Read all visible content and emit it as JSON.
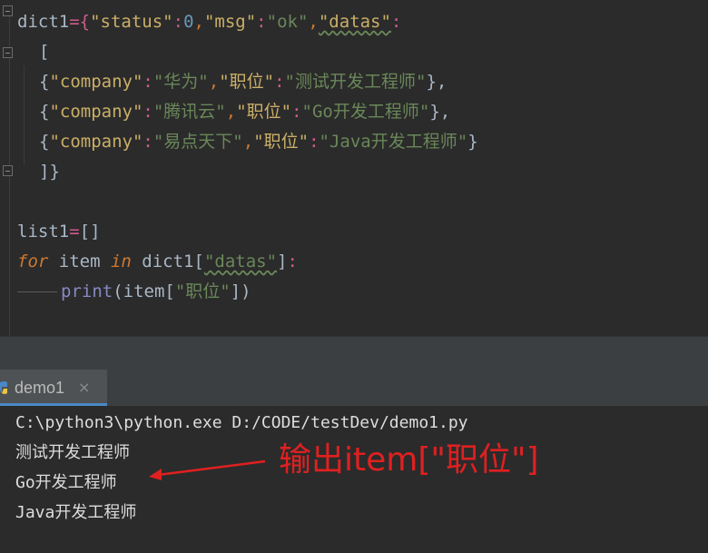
{
  "code": {
    "l1": {
      "a": "dict1",
      "b": "={",
      "c": "\"status\"",
      "d": ":",
      "e": "0",
      "f": ",",
      "g": "\"msg\"",
      "h": ":",
      "i": "\"ok\"",
      "j": ",",
      "k": "\"datas\"",
      "l": ":"
    },
    "l2": {
      "a": "["
    },
    "l3": {
      "a": "{",
      "b": "\"company\"",
      "c": ":",
      "d": "\"华为\"",
      "e": ",",
      "f": "\"职位\"",
      "g": ":",
      "h": "\"测试开发工程师\"",
      "i": "},"
    },
    "l4": {
      "a": "{",
      "b": "\"company\"",
      "c": ":",
      "d": "\"腾讯云\"",
      "e": ",",
      "f": "\"职位\"",
      "g": ":",
      "h": "\"Go开发工程师\"",
      "i": "},"
    },
    "l5": {
      "a": "{",
      "b": "\"company\"",
      "c": ":",
      "d": "\"易点天下\"",
      "e": ",",
      "f": "\"职位\"",
      "g": ":",
      "h": "\"Java开发工程师\"",
      "i": "}"
    },
    "l6": {
      "a": "]}"
    },
    "l8": {
      "a": "list1",
      "b": "=",
      "c": "[]"
    },
    "l9": {
      "a": "for",
      "b": " item ",
      "c": "in",
      "d": " dict1[",
      "e": "\"datas\"",
      "f": "]",
      "g": ":"
    },
    "l10": {
      "a": "print",
      "b": "(item[",
      "c": "\"职位\"",
      "d": "])"
    }
  },
  "run_panel": {
    "tab_label": "demo1",
    "close_glyph": "×",
    "tab_icon": "python-icon",
    "command": "C:\\python3\\python.exe D:/CODE/testDev/demo1.py",
    "output": [
      "测试开发工程师",
      "Go开发工程师",
      "Java开发工程师"
    ]
  },
  "annotation": {
    "text": "输出item[\"职位\"]",
    "color": "#e02020"
  },
  "colors": {
    "editor_bg": "#2b2b2b",
    "string": "#6a8759",
    "keyword": "#cc7832",
    "number": "#6897bb",
    "builtin": "#8888c6",
    "tab_underline": "#4a88c7"
  }
}
